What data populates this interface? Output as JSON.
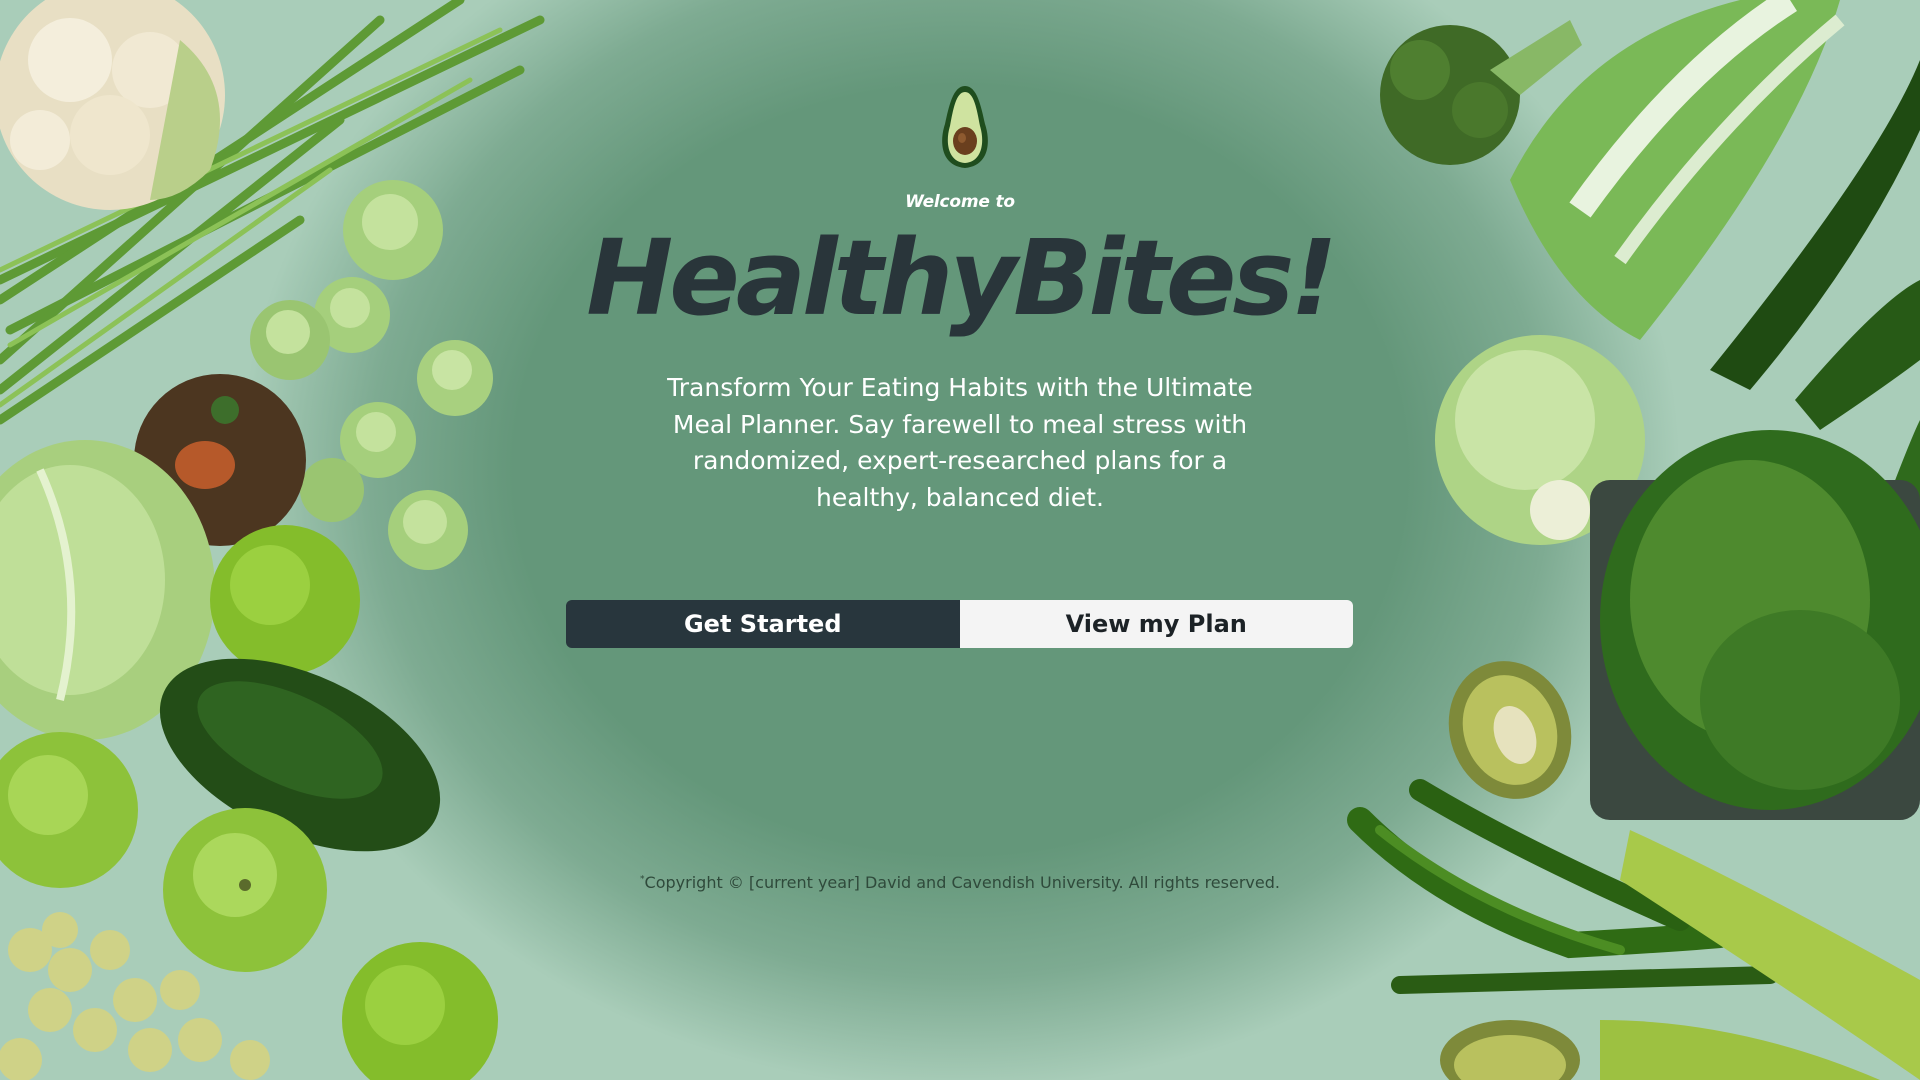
{
  "hero": {
    "welcome": "Welcome to",
    "brand": "HealthyBites!",
    "tagline": "Transform Your Eating Habits with the Ultimate Meal Planner. Say farewell to meal stress with randomized, expert-researched plans for a healthy, balanced diet."
  },
  "buttons": {
    "get_started": "Get Started",
    "view_plan": "View my Plan"
  },
  "footer": {
    "copyright_mark": "*",
    "copyright": "Copyright © [current year] David and Cavendish University. All rights reserved."
  },
  "colors": {
    "background": "#64977a",
    "brand_text": "#29353a",
    "primary_button": "#28363d",
    "secondary_button": "#f4f4f4"
  },
  "icons": {
    "logo": "avocado-icon"
  }
}
